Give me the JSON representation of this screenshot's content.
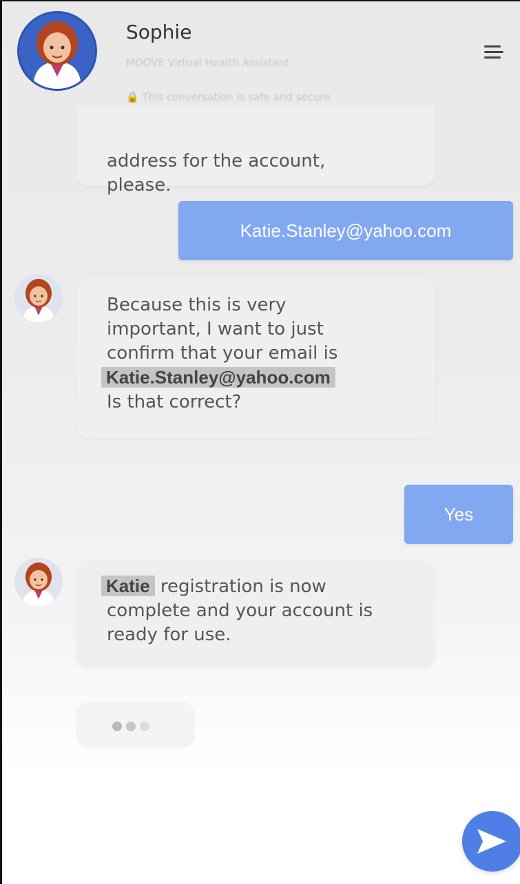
{
  "header": {
    "agent_name": "Sophie",
    "agent_subtitle": "MOOVE Virtual Health Assistant",
    "secure_note": "🔒 This conversation is safe and secure"
  },
  "messages": {
    "m1": {
      "text": "address for the account,\nplease."
    },
    "m2": {
      "text": "Katie.Stanley@yahoo.com"
    },
    "m3": {
      "line1": "Because this is very",
      "line2": "important, I want to just",
      "line3": "confirm that your email is",
      "email": "Katie.Stanley@yahoo.com",
      "line5": "Is that correct?"
    },
    "m4": {
      "text": "Yes"
    },
    "m5": {
      "name": "Katie",
      "rest_line1": "registration is now",
      "line2": "complete and your account is",
      "line3": "ready for use."
    }
  },
  "colors": {
    "user_bubble": "#82a8f2",
    "send_button": "#4f7ee6",
    "avatar_bg": "#3a63c4"
  },
  "icons": {
    "menu": "hamburger-menu-icon",
    "send": "send-arrow-icon",
    "typing": "typing-dots-icon"
  }
}
